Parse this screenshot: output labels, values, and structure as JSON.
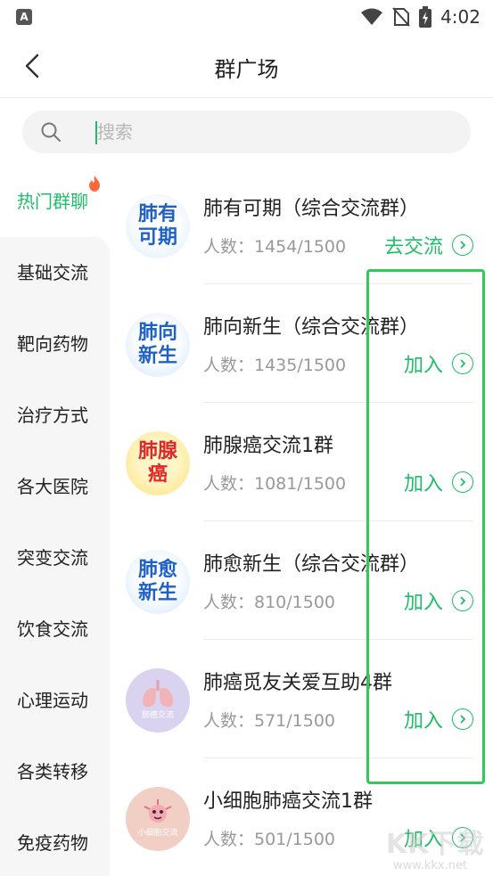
{
  "status_bar": {
    "app_icon_letter": "A",
    "time": "4:02",
    "icons": [
      "wifi-icon",
      "no-sim-icon",
      "battery-charging-icon"
    ]
  },
  "nav": {
    "title": "群广场",
    "back_icon": "chevron-left-icon"
  },
  "search": {
    "placeholder": "搜索",
    "icon": "search-icon"
  },
  "sidebar": {
    "items": [
      {
        "label": "热门群聊",
        "active": true,
        "badge_icon": "fire-icon"
      },
      {
        "label": "基础交流"
      },
      {
        "label": "靶向药物"
      },
      {
        "label": "治疗方式"
      },
      {
        "label": "各大医院"
      },
      {
        "label": "突变交流"
      },
      {
        "label": "饮食交流"
      },
      {
        "label": "心理运动"
      },
      {
        "label": "各类转移"
      },
      {
        "label": "免疫药物"
      }
    ]
  },
  "groups": [
    {
      "avatar_text": "肺有可期",
      "name": "肺有可期（综合交流群）",
      "members": "人数：1454/1500",
      "action": "去交流"
    },
    {
      "avatar_text": "肺向新生",
      "name": "肺向新生（综合交流群）",
      "members": "人数：1435/1500",
      "action": "加入"
    },
    {
      "avatar_text": "肺腺癌",
      "name": "肺腺癌交流1群",
      "members": "人数：1081/1500",
      "action": "加入"
    },
    {
      "avatar_text": "肺愈新生",
      "name": "肺愈新生（综合交流群）",
      "members": "人数：810/1500",
      "action": "加入"
    },
    {
      "avatar_text": "肺癌交流",
      "name": "肺癌觅友关爱互助4群",
      "members": "人数：571/1500",
      "action": "加入"
    },
    {
      "avatar_text": "小细胞交流",
      "name": "小细胞肺癌交流1群",
      "members": "人数：501/1500",
      "action": "加入"
    }
  ],
  "watermark": {
    "text": "KK下载",
    "sub": "www.kkx.net"
  },
  "colors": {
    "accent": "#1fbd6a",
    "highlight_box": "#34c759",
    "sidebar_bg": "#f6f6f6"
  }
}
